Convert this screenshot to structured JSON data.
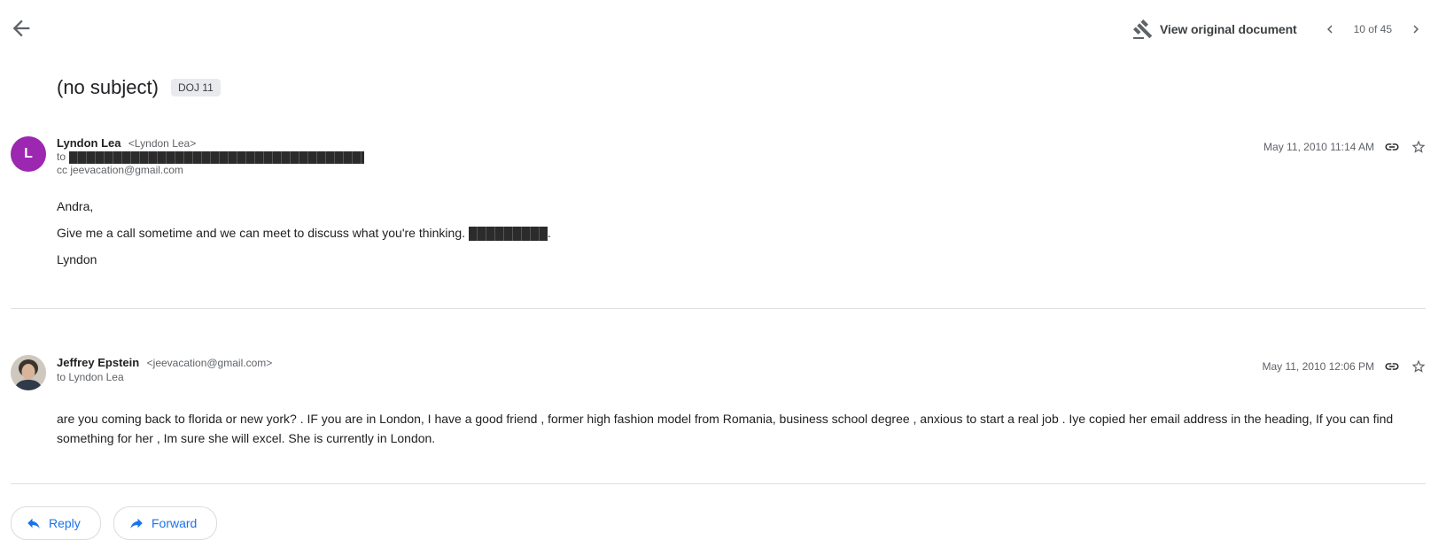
{
  "topbar": {
    "view_original_label": "View original document",
    "pager_text": "10 of 45"
  },
  "subject": {
    "title": "(no subject)",
    "label": "DOJ 11"
  },
  "messages": [
    {
      "avatar_letter": "L",
      "avatar_color": "#9c27b0",
      "sender_name": "Lyndon Lea",
      "sender_email": "<Lyndon Lea>",
      "to_prefix": "to",
      "cc_line": "cc jeevacation@gmail.com",
      "date": "May 11, 2010 11:14 AM",
      "body": {
        "greeting": "Andra,",
        "line1": "Give me a call sometime and we can meet to discuss what you're thinking.",
        "line1_end": ".",
        "signoff": "Lyndon"
      }
    },
    {
      "sender_name": "Jeffrey Epstein",
      "sender_email": "<jeevacation@gmail.com>",
      "to_line": "to Lyndon Lea",
      "date": "May 11, 2010 12:06 PM",
      "body": {
        "line1": "are you coming back to florida or new york? . IF you are in London, I have a good friend , former high fashion model from Romania, business school degree , anxious to start a real job . Iye copied her email address in the heading, If you can find",
        "line2": "something for her , Im sure she will excel. She is currently in London."
      }
    }
  ],
  "actions": {
    "reply_label": "Reply",
    "forward_label": "Forward"
  },
  "colors": {
    "accent": "#1a73e8",
    "avatar_purple": "#9c27b0"
  }
}
